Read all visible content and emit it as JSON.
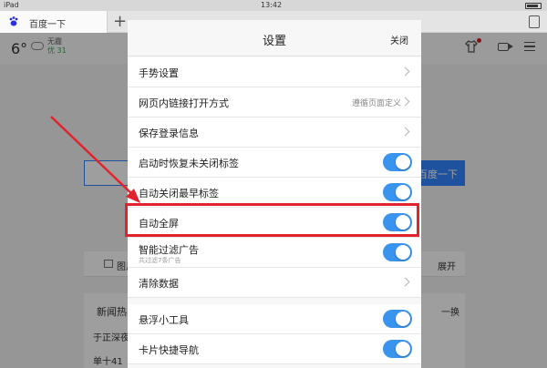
{
  "status_bar": {
    "carrier": "iPad",
    "time": "13:42"
  },
  "browser": {
    "tab_title": "百度一下",
    "new_tab_symbol": "+",
    "weather": {
      "temperature": "6°",
      "condition": "无霾",
      "aqi": "优 31"
    },
    "search_button_label": "百度一下",
    "image_tab_label": "图片",
    "expand_label": "展开",
    "news_title": "新闻热",
    "refresh_label": "一换",
    "news_items": [
      "于正深夜",
      "单十41"
    ]
  },
  "settings_modal": {
    "title": "设置",
    "close_label": "关闭",
    "rows": [
      {
        "label": "手势设置",
        "control": "chevron"
      },
      {
        "label": "网页内链接打开方式",
        "value": "遵循页面定义",
        "control": "chevron"
      },
      {
        "label": "保存登录信息",
        "control": "chevron"
      },
      {
        "label": "启动时恢复未关闭标签",
        "control": "toggle",
        "on": true
      },
      {
        "label": "自动关闭最早标签",
        "control": "toggle",
        "on": true
      },
      {
        "label": "自动全屏",
        "control": "toggle",
        "on": true,
        "highlighted": true
      },
      {
        "label": "智能过滤广告",
        "sublabel": "共过滤7条广告",
        "control": "toggle",
        "on": true
      },
      {
        "label": "清除数据",
        "control": "chevron"
      },
      {
        "label": "悬浮小工具",
        "control": "toggle",
        "on": true
      },
      {
        "label": "卡片快捷导航",
        "control": "toggle",
        "on": true
      }
    ]
  },
  "colors": {
    "toggle_on": "#3a94ee",
    "highlight": "#e3232b",
    "search_blue": "#3385ff"
  }
}
